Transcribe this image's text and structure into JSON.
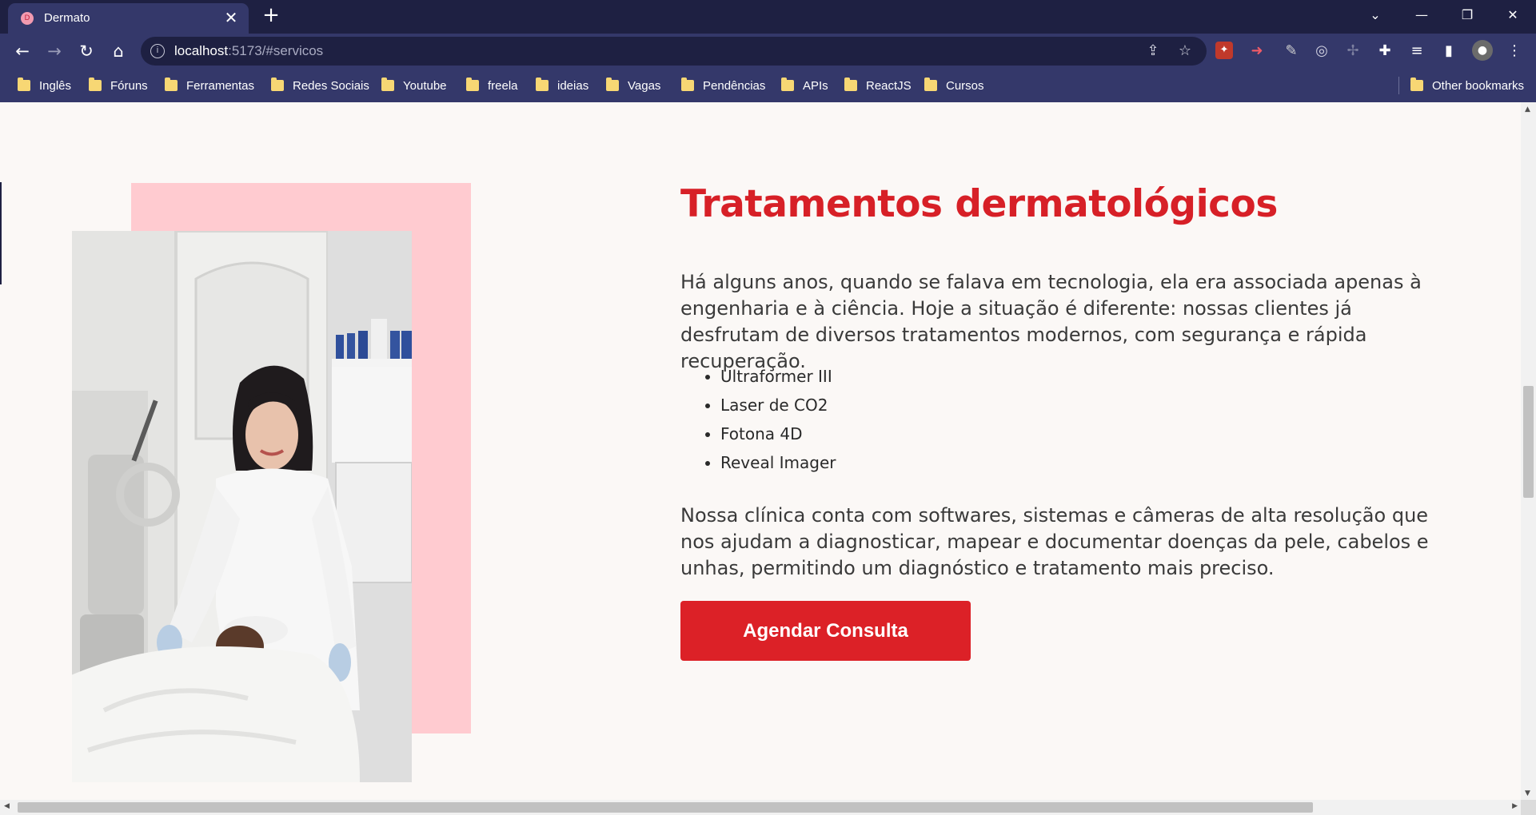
{
  "browser": {
    "tab_title": "Dermato",
    "tab_close": "✕",
    "new_tab": "+",
    "url_host": "localhost",
    "url_rest": ":5173/#servicos",
    "window_controls": {
      "tab_search": "⌄",
      "minimize": "—",
      "restore": "❐",
      "close": "✕"
    },
    "nav": {
      "back": "←",
      "forward": "→",
      "reload": "↻",
      "home": "⌂"
    },
    "bookmarks": [
      "Inglês",
      "Fóruns",
      "Ferramentas",
      "Redes Sociais",
      "Youtube",
      "freela",
      "ideias",
      "Vagas",
      "Pendências",
      "APIs",
      "ReactJS",
      "Cursos"
    ],
    "other_bookmarks": "Other bookmarks"
  },
  "section": {
    "title": "Tratamentos dermatológicos",
    "paragraph1": "Há alguns anos, quando se falava em tecnologia, ela era associada apenas à engenharia e à ciência. Hoje a situação é diferente: nossas clientes já desfrutam de diversos tratamentos modernos, com segurança e rápida recuperação.",
    "treatments": [
      "Ultraformer III",
      "Laser de CO2",
      "Fotona 4D",
      "Reveal Imager"
    ],
    "paragraph2": "Nossa clínica conta com softwares, sistemas e câmeras de alta resolução que nos ajudam a diagnosticar, mapear e documentar doenças da pele, cabelos e unhas, permitindo um diagnóstico e tratamento mais preciso.",
    "cta_label": "Agendar Consulta"
  },
  "colors": {
    "accent": "#dc2127",
    "title": "#d72027",
    "pink_block": "#ffcbd0",
    "page_bg": "#fbf8f6",
    "chrome_dark": "#1e2042",
    "chrome": "#34386a"
  }
}
